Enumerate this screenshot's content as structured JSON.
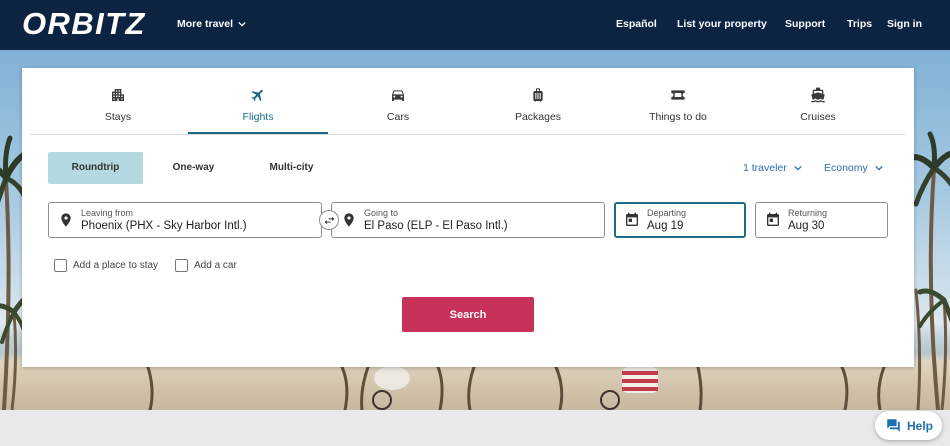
{
  "header": {
    "logo": "ORBITZ",
    "more_travel": "More travel",
    "nav": [
      "Español",
      "List your property",
      "Support",
      "Trips",
      "Sign in"
    ]
  },
  "tabs": [
    {
      "label": "Stays",
      "icon": "building-icon",
      "active": false
    },
    {
      "label": "Flights",
      "icon": "airplane-icon",
      "active": true
    },
    {
      "label": "Cars",
      "icon": "car-icon",
      "active": false
    },
    {
      "label": "Packages",
      "icon": "luggage-icon",
      "active": false
    },
    {
      "label": "Things to do",
      "icon": "ticket-icon",
      "active": false
    },
    {
      "label": "Cruises",
      "icon": "ship-icon",
      "active": false
    }
  ],
  "trip_types": [
    {
      "label": "Roundtrip",
      "selected": true
    },
    {
      "label": "One-way",
      "selected": false
    },
    {
      "label": "Multi-city",
      "selected": false
    }
  ],
  "travelers": "1 traveler",
  "cabin_class": "Economy",
  "fields": {
    "leaving_from": {
      "label": "Leaving from",
      "value": "Phoenix (PHX - Sky Harbor Intl.)",
      "icon": "map-pin-icon"
    },
    "going_to": {
      "label": "Going to",
      "value": "El Paso (ELP - El Paso Intl.)",
      "icon": "map-pin-icon"
    },
    "departing": {
      "label": "Departing",
      "value": "Aug 19",
      "icon": "calendar-icon",
      "focused": true
    },
    "returning": {
      "label": "Returning",
      "value": "Aug 30",
      "icon": "calendar-icon",
      "focused": false
    }
  },
  "addons": [
    {
      "label": "Add a place to stay",
      "checked": false
    },
    {
      "label": "Add a car",
      "checked": false
    }
  ],
  "search_label": "Search",
  "help": {
    "label": "Help",
    "icon": "chat-icon"
  },
  "colors": {
    "header_bg": "#0c2442",
    "accent": "#1c6b86",
    "link": "#2a6fb0",
    "search_button": "#c8325a",
    "selected_trip_bg": "#b4d9e0"
  }
}
